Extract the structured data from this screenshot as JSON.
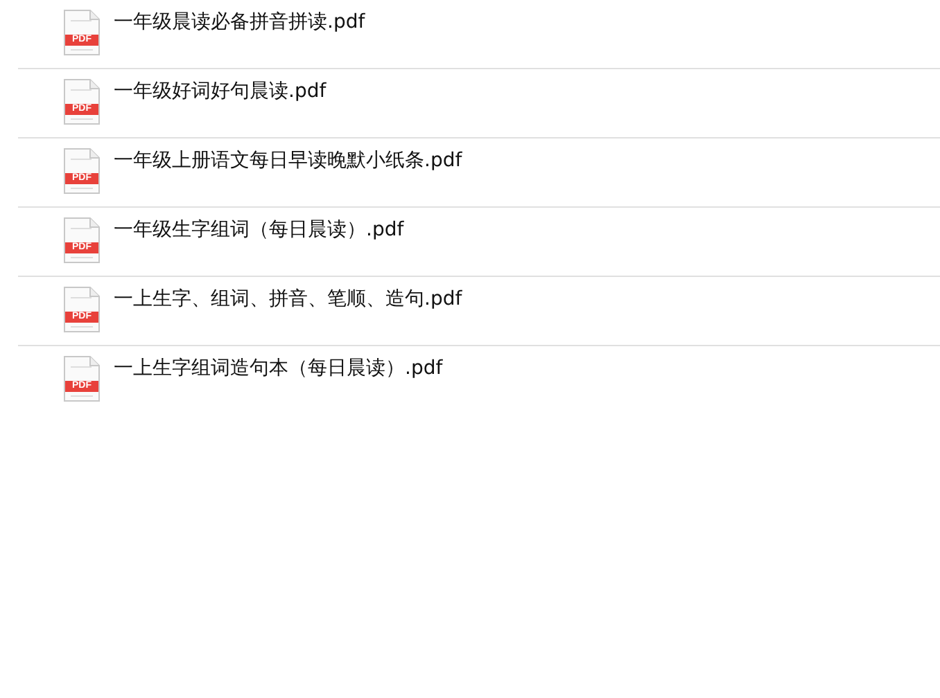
{
  "files": [
    {
      "name": "一年级晨读必备拼音拼读.pdf",
      "icon_label": "PDF"
    },
    {
      "name": "一年级好词好句晨读.pdf",
      "icon_label": "PDF"
    },
    {
      "name": "一年级上册语文每日早读晚默小纸条.pdf",
      "icon_label": "PDF"
    },
    {
      "name": "一年级生字组词（每日晨读）.pdf",
      "icon_label": "PDF"
    },
    {
      "name": "一上生字、组词、拼音、笔顺、造句.pdf",
      "icon_label": "PDF"
    },
    {
      "name": "一上生字组词造句本（每日晨读）.pdf",
      "icon_label": "PDF"
    }
  ]
}
